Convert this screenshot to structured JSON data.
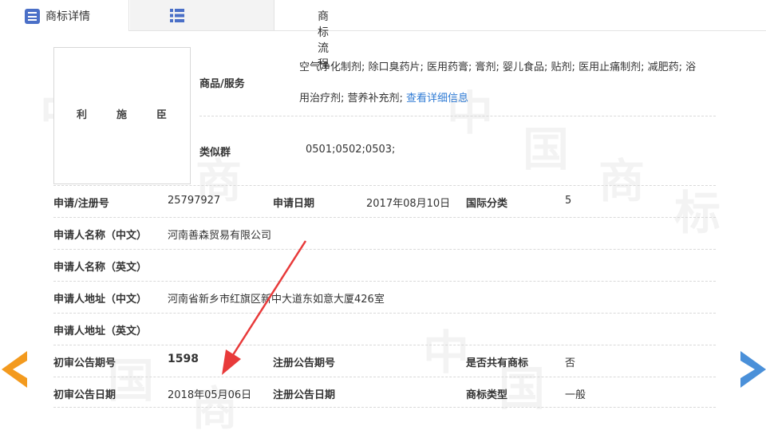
{
  "tabs": [
    {
      "label": "商标详情",
      "icon": "list-icon"
    },
    {
      "label": "商标流程",
      "icon": "grid-list-icon"
    }
  ],
  "logo": {
    "text": [
      "利",
      "施",
      "臣"
    ]
  },
  "goods": {
    "label": "商品/服务",
    "line1": "空气净化制剂; 除口臭药片; 医用药膏; 膏剂; 婴儿食品; 贴剂; 医用止痛制剂; 减肥药; 浴",
    "line2": "用治疗剂; 营养补充剂;",
    "link": "查看详细信息"
  },
  "similar_group": {
    "label": "类似群",
    "value": "0501;0502;0503;"
  },
  "rows": {
    "reg_no": {
      "label": "申请/注册号",
      "value": "25797927"
    },
    "apply_date": {
      "label": "申请日期",
      "value": "2017年08月10日"
    },
    "intl_class": {
      "label": "国际分类",
      "value": "5"
    },
    "applicant_cn": {
      "label": "申请人名称（中文）",
      "value": "河南善森贸易有限公司"
    },
    "applicant_en": {
      "label": "申请人名称（英文）",
      "value": ""
    },
    "address_cn": {
      "label": "申请人地址（中文）",
      "value": "河南省新乡市红旗区新中大道东如意大厦426室"
    },
    "address_en": {
      "label": "申请人地址（英文）",
      "value": ""
    },
    "prelim_no": {
      "label": "初审公告期号",
      "value": "1598"
    },
    "reg_pub_no": {
      "label": "注册公告期号",
      "value": ""
    },
    "shared": {
      "label": "是否共有商标",
      "value": "否"
    },
    "prelim_date": {
      "label": "初审公告日期",
      "value": "2018年05月06日"
    },
    "reg_pub_date": {
      "label": "注册公告日期",
      "value": ""
    },
    "tm_type": {
      "label": "商标类型",
      "value": "一般"
    }
  },
  "watermark": [
    "中",
    "国",
    "商",
    "标"
  ],
  "colors": {
    "arrow_left": "#f39a1e",
    "arrow_right": "#4a90d9",
    "annotation": "#e83a3a",
    "link": "#2f7bd4"
  }
}
